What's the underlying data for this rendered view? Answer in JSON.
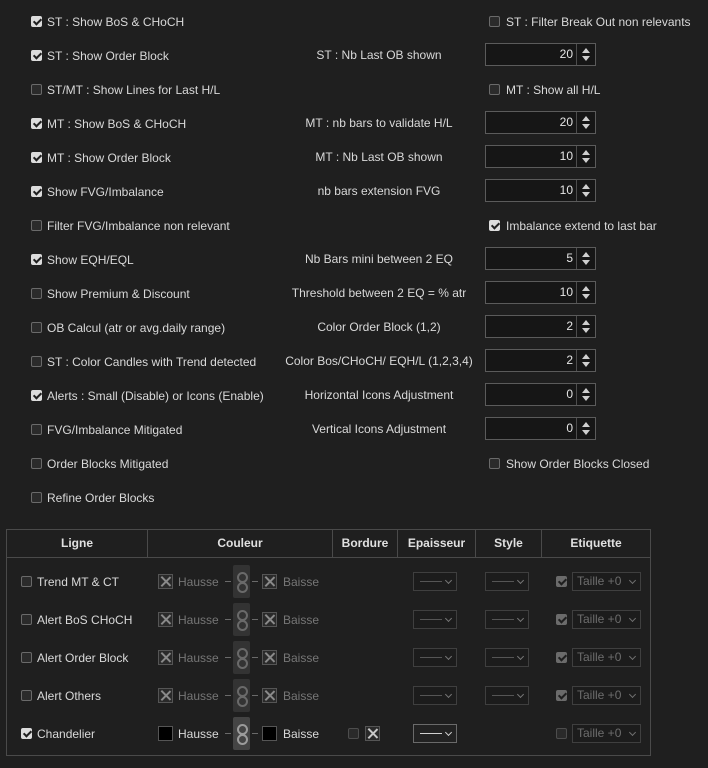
{
  "left_checks": [
    {
      "label": "ST : Show BoS & CHoCH",
      "checked": true
    },
    {
      "label": "ST : Show Order Block",
      "checked": true
    },
    {
      "label": "ST/MT : Show Lines for Last H/L",
      "checked": false
    },
    {
      "label": "MT : Show BoS & CHoCH",
      "checked": true
    },
    {
      "label": "MT : Show Order Block",
      "checked": true
    },
    {
      "label": "Show FVG/Imbalance",
      "checked": true
    },
    {
      "label": "Filter FVG/Imbalance non relevant",
      "checked": false
    },
    {
      "label": "Show EQH/EQL",
      "checked": true
    },
    {
      "label": "Show Premium & Discount",
      "checked": false
    },
    {
      "label": "OB Calcul (atr or avg.daily range)",
      "checked": false
    },
    {
      "label": "ST : Color Candles with Trend detected",
      "checked": false
    },
    {
      "label": "Alerts : Small (Disable) or Icons (Enable)",
      "checked": true
    },
    {
      "label": "FVG/Imbalance Mitigated",
      "checked": false
    },
    {
      "label": "Order Blocks Mitigated",
      "checked": false
    },
    {
      "label": "Refine Order Blocks",
      "checked": false
    }
  ],
  "right_checks": [
    {
      "label": "ST : Filter Break Out non relevants",
      "checked": false
    },
    {
      "label": "MT : Show all H/L",
      "checked": false
    },
    {
      "label": "Imbalance extend to last bar",
      "checked": true
    },
    {
      "label": "Show Order Blocks Closed",
      "checked": false
    }
  ],
  "spinners": [
    {
      "label": "ST : Nb Last OB shown",
      "value": "20"
    },
    {
      "label": "MT : nb bars to validate H/L",
      "value": "20"
    },
    {
      "label": "MT : Nb Last  OB shown",
      "value": "10"
    },
    {
      "label": "nb bars extension FVG",
      "value": "10"
    },
    {
      "label": "Nb Bars mini between 2 EQ",
      "value": "5"
    },
    {
      "label": "Threshold between 2 EQ = % atr",
      "value": "10"
    },
    {
      "label": "Color Order Block (1,2)",
      "value": "2"
    },
    {
      "label": "Color Bos/CHoCH/ EQH/L (1,2,3,4)",
      "value": "2"
    },
    {
      "label": "Horizontal Icons Adjustment",
      "value": "0"
    },
    {
      "label": "Vertical Icons Adjustment",
      "value": "0"
    }
  ],
  "grid": {
    "headers": {
      "ligne": "Ligne",
      "couleur": "Couleur",
      "bordure": "Bordure",
      "epaisseur": "Epaisseur",
      "style": "Style",
      "etiquette": "Etiquette"
    },
    "rows": [
      {
        "name": "Trend MT & CT",
        "checked": false,
        "hausse": "Hausse",
        "baisse": "Baisse",
        "taille": "Taille +0",
        "label_checked": true
      },
      {
        "name": "Alert BoS CHoCH",
        "checked": false,
        "hausse": "Hausse",
        "baisse": "Baisse",
        "taille": "Taille +0",
        "label_checked": true
      },
      {
        "name": "Alert Order Block",
        "checked": false,
        "hausse": "Hausse",
        "baisse": "Baisse",
        "taille": "Taille +0",
        "label_checked": true
      },
      {
        "name": "Alert Others",
        "checked": false,
        "hausse": "Hausse",
        "baisse": "Baisse",
        "taille": "Taille +0",
        "label_checked": true
      },
      {
        "name": "Chandelier",
        "checked": true,
        "hausse": "Hausse",
        "baisse": "Baisse",
        "taille": "Taille +0",
        "label_checked": false
      }
    ]
  },
  "colors": {
    "background": "#1f1f1f",
    "text": "#d9d9d9",
    "border": "#4a4a4a"
  }
}
